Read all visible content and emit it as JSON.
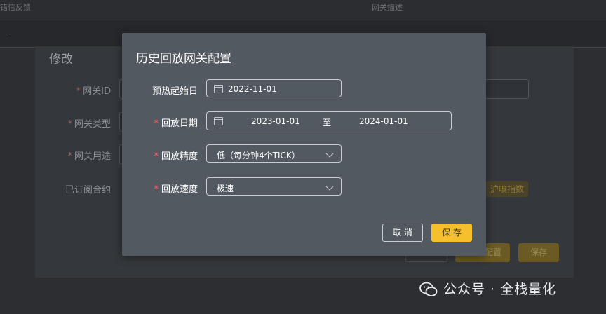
{
  "background": {
    "header_col1": "错信反馈",
    "header_col2": "网关描述",
    "row_value": "-",
    "dialog_title": "修改",
    "labels": [
      "网关ID",
      "网关类型",
      "网关用途",
      "已订阅合约"
    ],
    "chip": "沪嗅指数",
    "btn_config": "配置",
    "btn_save": "保存"
  },
  "modal": {
    "title": "历史回放网关配置",
    "fields": {
      "warmup_label": "预热起始日",
      "warmup_value": "2022-11-01",
      "date_label": "回放日期",
      "date_start": "2023-01-01",
      "date_sep": "至",
      "date_end": "2024-01-01",
      "precision_label": "回放精度",
      "precision_value": "低（每分钟4个TICK）",
      "speed_label": "回放速度",
      "speed_value": "极速"
    },
    "cancel_label": "取 消",
    "save_label": "保 存"
  },
  "watermark": "公众号 · 全栈量化",
  "colors": {
    "accent": "#f5c02c",
    "modal_bg": "#525960",
    "page_bg": "#2c2e32",
    "required": "#ff6b6b"
  }
}
